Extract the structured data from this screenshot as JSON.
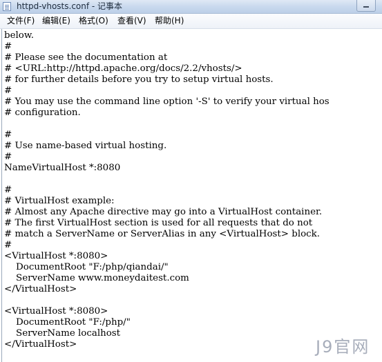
{
  "window": {
    "title": "httpd-vhosts.conf - 记事本"
  },
  "menu": {
    "items": [
      {
        "label": "文件(F)"
      },
      {
        "label": "编辑(E)"
      },
      {
        "label": "格式(O)"
      },
      {
        "label": "查看(V)"
      },
      {
        "label": "帮助(H)"
      }
    ]
  },
  "editor": {
    "lines": [
      "below.",
      "#",
      "# Please see the documentation at",
      "# <URL:http://httpd.apache.org/docs/2.2/vhosts/>",
      "# for further details before you try to setup virtual hosts.",
      "#",
      "# You may use the command line option '-S' to verify your virtual hos",
      "# configuration.",
      "",
      "#",
      "# Use name-based virtual hosting.",
      "#",
      "NameVirtualHost *:8080",
      "",
      "#",
      "# VirtualHost example:",
      "# Almost any Apache directive may go into a VirtualHost container.",
      "# The first VirtualHost section is used for all requests that do not",
      "# match a ServerName or ServerAlias in any <VirtualHost> block.",
      "#",
      "<VirtualHost *:8080>",
      "    DocumentRoot \"F:/php/qiandai/\"",
      "    ServerName www.moneydaitest.com",
      "</VirtualHost>",
      "",
      "<VirtualHost *:8080>",
      "    DocumentRoot \"F:/php/\"",
      "    ServerName localhost",
      "</VirtualHost>"
    ]
  },
  "watermark": {
    "text": "J9官网"
  }
}
